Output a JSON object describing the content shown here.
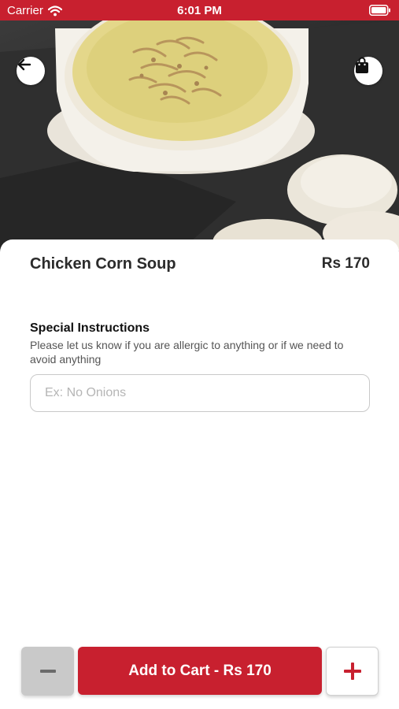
{
  "status_bar": {
    "carrier": "Carrier",
    "time": "6:01 PM",
    "wifi_icon": "wifi-icon",
    "battery_icon": "battery-icon"
  },
  "header": {
    "back_icon": "arrow-left-icon",
    "bag_icon": "shopping-bag-icon"
  },
  "item": {
    "name": "Chicken Corn Soup",
    "price": "Rs 170"
  },
  "special_instructions": {
    "heading": "Special Instructions",
    "description": "Please let us know if you are allergic to anything or if we need to avoid anything",
    "value": "",
    "placeholder": "Ex: No Onions"
  },
  "footer": {
    "minus_icon": "minus-icon",
    "add_to_cart_label": "Add to Cart - Rs 170",
    "plus_icon": "plus-icon"
  },
  "colors": {
    "accent": "#c8202f",
    "minus_button_bg": "#c9c9c9",
    "text_dark": "#2b2b2b"
  }
}
